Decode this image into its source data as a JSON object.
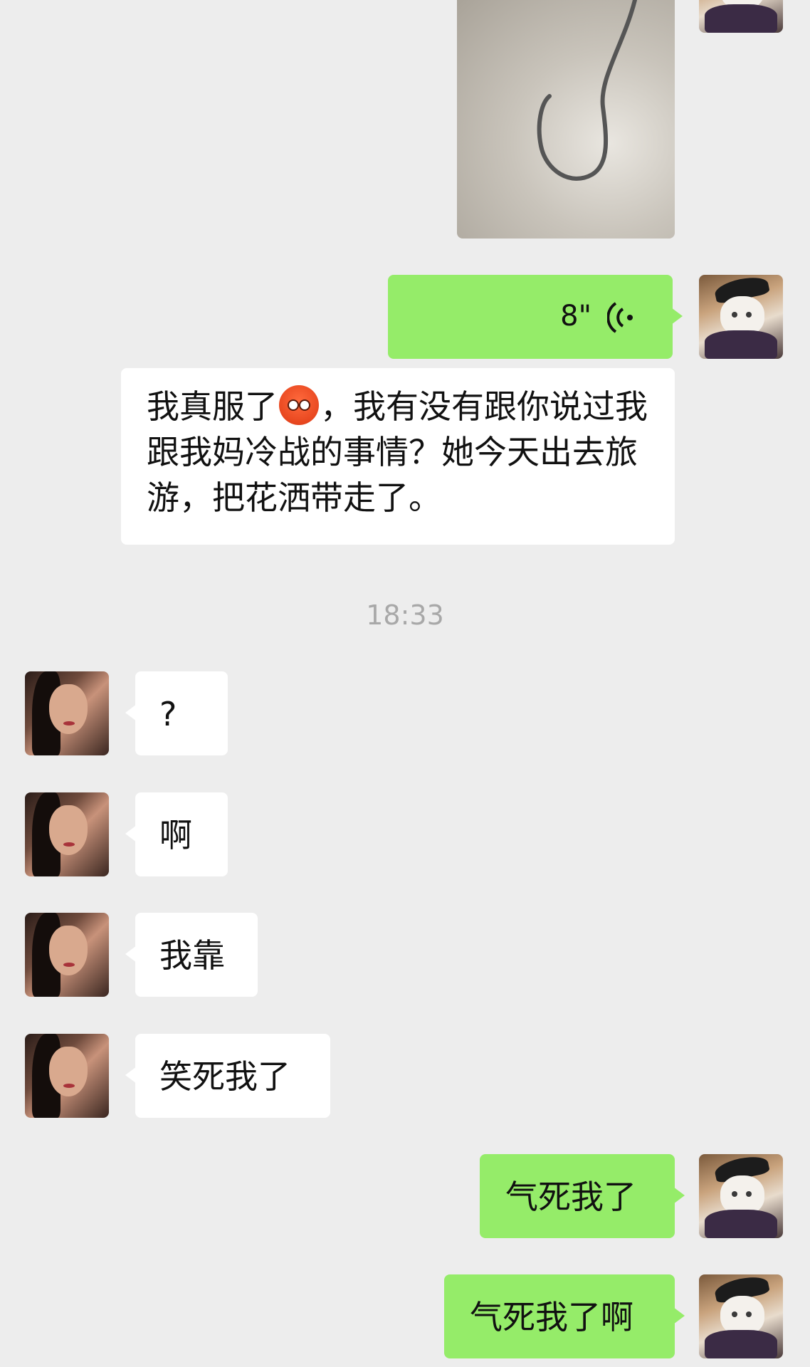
{
  "chat": {
    "voice_duration": "8\"",
    "msg_long": "我真服了😡，我有没有跟你说过我跟我妈冷战的事情？她今天出去旅游，把花洒带走了。",
    "msg_long_part1": "我真服了",
    "msg_long_part2": "，我有没有跟你说过我跟我妈冷战的事情？她今天出去旅游，把花洒带走了。",
    "timestamp": "18:33",
    "reply_1": "?",
    "reply_2": "啊",
    "reply_3": "我靠",
    "reply_4": "笑死我了",
    "my_msg_1": "气死我了",
    "my_msg_2": "气死我了啊"
  },
  "colors": {
    "sent_bubble": "#95ec69",
    "recv_bubble": "#ffffff",
    "background": "#ededed"
  },
  "icons": {
    "voice": "voice-wave-icon",
    "emoji": "angry-face-emoji"
  }
}
